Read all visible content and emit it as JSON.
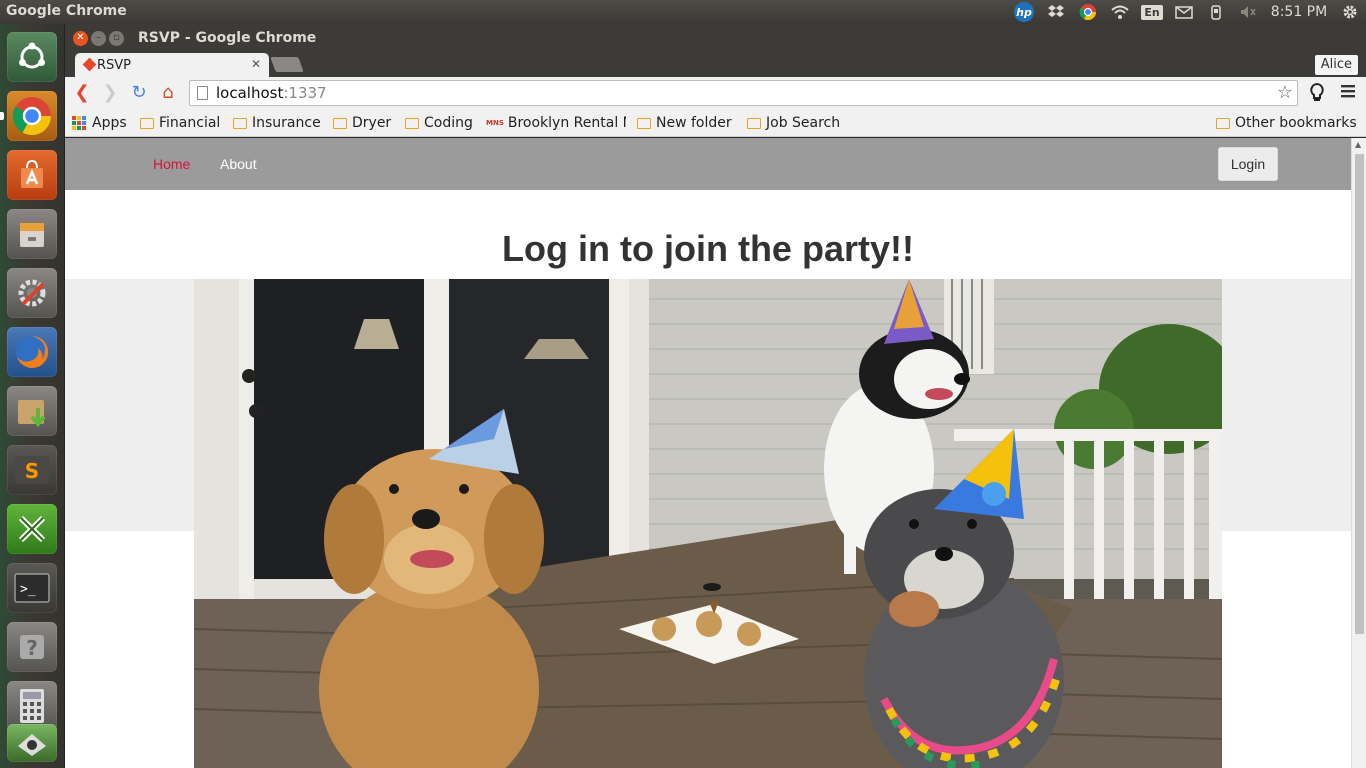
{
  "os": {
    "active_app": "Google Chrome",
    "clock": "8:51 PM",
    "keyboard_lang": "En",
    "hp_label": "hp"
  },
  "launcher": {
    "items": [
      "Dash",
      "Google Chrome",
      "Ubuntu Software Center",
      "Files",
      "System Settings",
      "Firefox",
      "Archive Manager",
      "Sublime Text",
      "XMind",
      "Terminal",
      "Help",
      "Calculator",
      "Workspace Switcher"
    ],
    "sublime_glyph": "S",
    "help_glyph": "?",
    "terminal_glyph": ">_"
  },
  "window": {
    "title": "RSVP - Google Chrome",
    "profile": "Alice"
  },
  "tabs": [
    {
      "label": "RSVP",
      "active": true
    }
  ],
  "address": {
    "host": "localhost",
    "port": ":1337"
  },
  "bookmarks": [
    "Apps",
    "Financial",
    "Insurance",
    "Dryer",
    "Coding",
    "Brooklyn Rental M",
    "New folder",
    "Job Search"
  ],
  "bookmarks_other": "Other bookmarks",
  "brooklyn_badge": "MNS",
  "page": {
    "nav": {
      "home": "Home",
      "about": "About",
      "login": "Login"
    },
    "headline": "Log in to join the party!!",
    "photo_desc": "three dogs in party hats"
  },
  "colors": {
    "nav_active": "#d6133a",
    "navbar_bg": "#9b9b9b",
    "ubuntu_orange": "#e95420"
  }
}
